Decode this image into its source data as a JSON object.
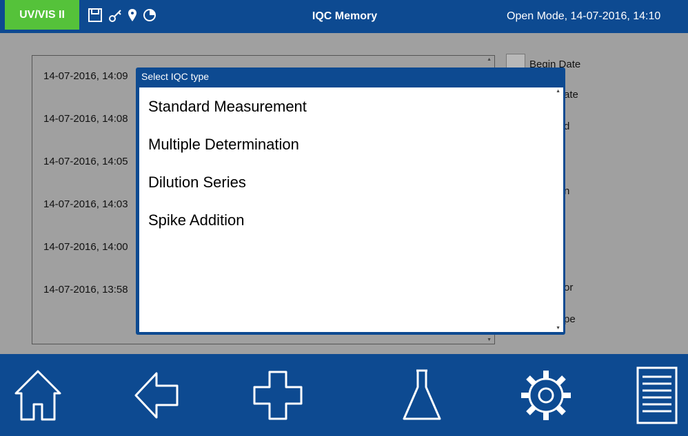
{
  "header": {
    "product": "UV/VIS II",
    "title": "IQC Memory",
    "mode": "Open Mode, 14-07-2016, 14:10",
    "status_icons": [
      "floppy-disk-icon",
      "key-icon",
      "location-pin-icon",
      "pie-chart-icon"
    ]
  },
  "memory_list": {
    "rows": [
      "14-07-2016, 14:09",
      "14-07-2016, 14:08",
      "14-07-2016, 14:05",
      "14-07-2016, 14:03",
      "14-07-2016, 14:00",
      "14-07-2016, 13:58"
    ]
  },
  "filters": {
    "begin_date": "Begin Date",
    "partial_labels": [
      "ate",
      "d",
      "n",
      "or",
      "pe"
    ]
  },
  "dialog": {
    "title": "Select IQC type",
    "options": [
      "Standard Measurement",
      "Multiple Determination",
      "Dilution Series",
      "Spike Addition"
    ]
  },
  "bottom_nav": {
    "buttons": [
      "home-icon",
      "back-arrow-icon",
      "add-plus-icon",
      "flask-icon",
      "settings-gear-icon",
      "menu-list-icon"
    ]
  },
  "colors": {
    "header_blue": "#0d4a91",
    "badge_green": "#55c23a",
    "background_gray": "#a0a0a0"
  }
}
